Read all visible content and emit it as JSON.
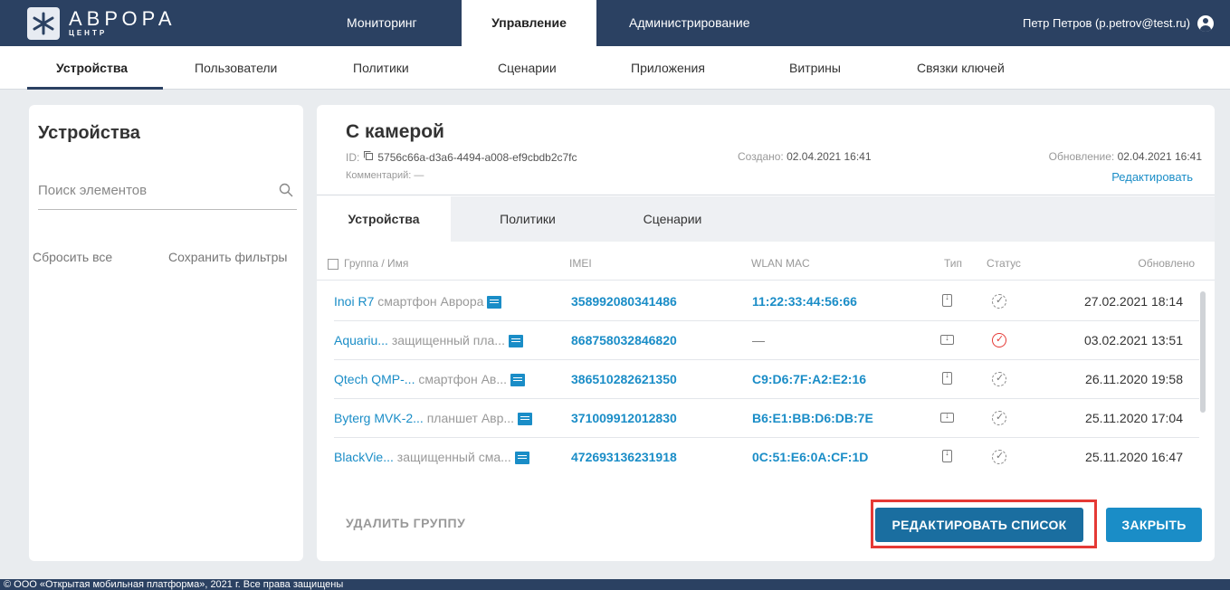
{
  "app": {
    "logo_name": "АВРОРА",
    "logo_sub": "ЦЕНТР",
    "user": "Петр Петров (p.petrov@test.ru)"
  },
  "top_nav": [
    {
      "label": "Мониторинг"
    },
    {
      "label": "Управление"
    },
    {
      "label": "Администрирование"
    }
  ],
  "sub_nav": [
    {
      "label": "Устройства"
    },
    {
      "label": "Пользователи"
    },
    {
      "label": "Политики"
    },
    {
      "label": "Сценарии"
    },
    {
      "label": "Приложения"
    },
    {
      "label": "Витрины"
    },
    {
      "label": "Связки ключей"
    }
  ],
  "left_panel": {
    "title": "Устройства",
    "search_placeholder": "Поиск элементов",
    "reset_label": "Сбросить все",
    "save_filters_label": "Сохранить фильтры"
  },
  "group": {
    "title": "С камерой",
    "id_label": "ID:",
    "id_value": "5756c66a-d3a6-4494-a008-ef9cbdb2c7fc",
    "comment_label": "Комментарий: —",
    "created_label": "Создано:",
    "created_value": "02.04.2021 16:41",
    "updated_label": "Обновление:",
    "updated_value": "02.04.2021 16:41",
    "edit_link": "Редактировать"
  },
  "tabs": [
    {
      "label": "Устройства"
    },
    {
      "label": "Политики"
    },
    {
      "label": "Сценарии"
    }
  ],
  "table": {
    "columns": {
      "name": "Группа / Имя",
      "imei": "IMEI",
      "mac": "WLAN MAC",
      "type": "Тип",
      "status": "Статус",
      "updated": "Обновлено"
    },
    "rows": [
      {
        "name": "Inoi R7",
        "group": "смартфон Аврора",
        "imei": "358992080341486",
        "mac": "11:22:33:44:56:66",
        "type": "phone-icon",
        "status": "ok",
        "updated": "27.02.2021 18:14"
      },
      {
        "name": "Aquariu...",
        "group": "защищенный пла...",
        "imei": "868758032846820",
        "mac": "—",
        "type": "tablet-icon",
        "status": "error",
        "updated": "03.02.2021 13:51"
      },
      {
        "name": "Qtech QMP-...",
        "group": "смартфон Ав...",
        "imei": "386510282621350",
        "mac": "C9:D6:7F:A2:E2:16",
        "type": "phone-icon",
        "status": "ok",
        "updated": "26.11.2020 19:58"
      },
      {
        "name": "Byterg MVK-2...",
        "group": "планшет Авр...",
        "imei": "371009912012830",
        "mac": "B6:E1:BB:D6:DB:7E",
        "type": "tablet-icon",
        "status": "ok",
        "updated": "25.11.2020 17:04"
      },
      {
        "name": "BlackVie...",
        "group": "защищенный сма...",
        "imei": "472693136231918",
        "mac": "0C:51:E6:0A:CF:1D",
        "type": "phone-icon",
        "status": "ok",
        "updated": "25.11.2020 16:47"
      }
    ]
  },
  "actions": {
    "delete_group": "УДАЛИТЬ ГРУППУ",
    "edit_list": "РЕДАКТИРОВАТЬ СПИСОК",
    "close": "ЗАКРЫТЬ"
  },
  "footer": {
    "text": "© ООО «Открытая мобильная платформа», 2021 г. Все права защищены"
  },
  "colors": {
    "nav_bg": "#2b4162",
    "accent": "#1a8dc7",
    "highlight": "#e53935"
  }
}
